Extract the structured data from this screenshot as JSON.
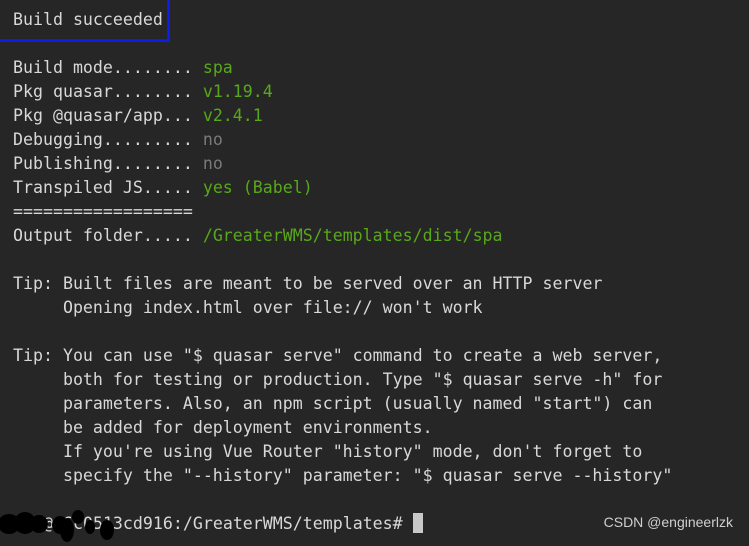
{
  "status": {
    "title": "Build succeeded",
    "highlight_color": "#0a1ee8"
  },
  "summary": [
    {
      "label": "Build mode........ ",
      "value": "spa",
      "tone": "green"
    },
    {
      "label": "Pkg quasar........ ",
      "value": "v1.19.4",
      "tone": "green"
    },
    {
      "label": "Pkg @quasar/app... ",
      "value": "v2.4.1",
      "tone": "green"
    },
    {
      "label": "Debugging......... ",
      "value": "no",
      "tone": "gray"
    },
    {
      "label": "Publishing........ ",
      "value": "no",
      "tone": "gray"
    },
    {
      "label": "Transpiled JS..... ",
      "value": "yes (Babel)",
      "tone": "green"
    }
  ],
  "separator": "==================",
  "output": {
    "label": "Output folder..... ",
    "value": "/GreaterWMS/templates/dist/spa"
  },
  "tips": [
    [
      "Tip: Built files are meant to be served over an HTTP server",
      "     Opening index.html over file:// won't work"
    ],
    [
      "Tip: You can use \"$ quasar serve\" command to create a web server,",
      "     both for testing or production. Type \"$ quasar serve -h\" for",
      "     parameters. Also, an npm script (usually named \"start\") can",
      "     be added for deployment environments.",
      "     If you're using Vue Router \"history\" mode, don't forget to",
      "     specify the \"--history\" parameter: \"$ quasar serve --history\""
    ]
  ],
  "prompt": "@e6c0513cd916:/GreaterWMS/templates#",
  "watermark": "CSDN @engineerlzk",
  "colors": {
    "background": "#262626",
    "text": "#d8d8d8",
    "green": "#58a81a",
    "gray": "#7a7a7a"
  }
}
